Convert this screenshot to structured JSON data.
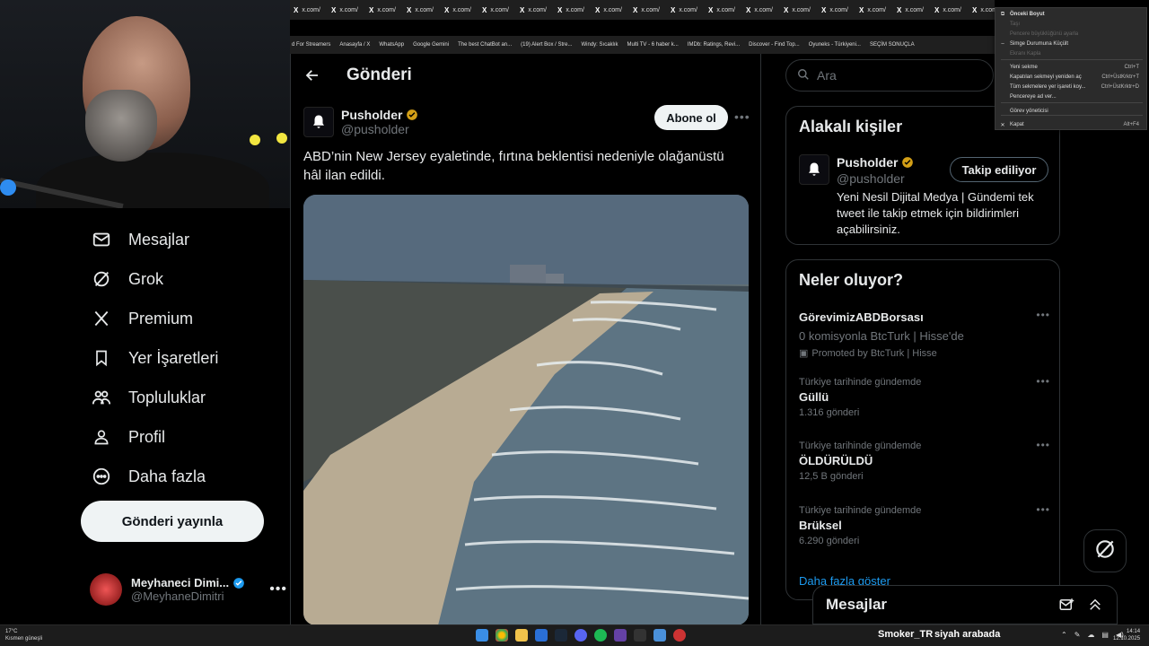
{
  "browser": {
    "tab_label": "x.com/",
    "tab_count": 19,
    "bookmarks": [
      "d For Streamers",
      "Anasayfa / X",
      "WhatsApp",
      "Google Gemini",
      "The best ChatBot an...",
      "(19) Alert Box / Stre...",
      "Windy: Sıcaklık",
      "Multi TV - 6 haber k...",
      "IMDb: Ratings, Revi...",
      "Discover - Find Top...",
      "Oyuneks - Türkiyeni...",
      "SEÇİM SONUÇLA"
    ]
  },
  "context_menu": {
    "items": [
      {
        "label": "Önceki Boyut",
        "shortcut": "",
        "enabled": true,
        "bold": true
      },
      {
        "label": "Taşı",
        "shortcut": "",
        "enabled": false
      },
      {
        "label": "Pencere büyüklüğünü ayarla",
        "shortcut": "",
        "enabled": false
      },
      {
        "label": "Simge Durumuna Küçült",
        "shortcut": "",
        "enabled": true
      },
      {
        "label": "Ekranı Kapla",
        "shortcut": "",
        "enabled": false
      },
      {
        "label": "Yeni sekme",
        "shortcut": "Ctrl+T",
        "enabled": true
      },
      {
        "label": "Kapatılan sekmeyi yeniden aç",
        "shortcut": "Ctrl+ÜstKrktr+T",
        "enabled": true
      },
      {
        "label": "Tüm sekmelere yer işareti koy...",
        "shortcut": "Ctrl+ÜstKrktr+D",
        "enabled": true
      },
      {
        "label": "Pencereye ad ver...",
        "shortcut": "",
        "enabled": true
      },
      {
        "label": "Görev yöneticisi",
        "shortcut": "",
        "enabled": true
      },
      {
        "label": "Kapat",
        "shortcut": "Alt+F4",
        "enabled": true
      }
    ]
  },
  "sidebar": {
    "items": [
      {
        "label": "Mesajlar",
        "icon": "envelope-icon"
      },
      {
        "label": "Grok",
        "icon": "grok-icon"
      },
      {
        "label": "Premium",
        "icon": "x-logo-icon"
      },
      {
        "label": "Yer İşaretleri",
        "icon": "bookmark-icon"
      },
      {
        "label": "Topluluklar",
        "icon": "communities-icon"
      },
      {
        "label": "Profil",
        "icon": "person-icon"
      },
      {
        "label": "Daha fazla",
        "icon": "more-circle-icon"
      }
    ],
    "post_button": "Gönderi yayınla",
    "account": {
      "name": "Meyhaneci Dimi...",
      "handle": "@MeyhaneDimitri"
    }
  },
  "main": {
    "title": "Gönderi",
    "post": {
      "author_name": "Pusholder",
      "author_handle": "@pusholder",
      "subscribe_label": "Abone ol",
      "text": "ABD’nin New Jersey eyaletinde, fırtına beklentisi nedeniyle olağanüstü hâl ilan edildi."
    }
  },
  "right": {
    "search_placeholder": "Ara",
    "related": {
      "title": "Alakalı kişiler",
      "name": "Pusholder",
      "handle": "@pusholder",
      "follow_label": "Takip ediliyor",
      "bio": "Yeni Nesil Dijital Medya | Gündemi tek tweet ile takip etmek için bildirimleri açabilirsiniz."
    },
    "trends": {
      "title": "Neler oluyor?",
      "promoted": {
        "title": "GörevimizABDBorsası",
        "desc": "0 komisyonla BtcTurk | Hisse'de",
        "by": "Promoted by BtcTurk | Hisse"
      },
      "items": [
        {
          "context": "Türkiye tarihinde gündemde",
          "title": "Güllü",
          "count": "1.316 gönderi"
        },
        {
          "context": "Türkiye tarihinde gündemde",
          "title": "ÖLDÜRÜLDÜ",
          "count": "12,5 B gönderi"
        },
        {
          "context": "Türkiye tarihinde gündemde",
          "title": "Brüksel",
          "count": "6.290 gönderi"
        }
      ],
      "show_more": "Daha fazla göster"
    },
    "messages_drawer": "Mesajlar"
  },
  "taskbar": {
    "weather_temp": "17°C",
    "weather_desc": "Kısmen güneşli",
    "now_playing_user": "Smoker_TR",
    "now_playing_text": "siyah arabada",
    "time": "14:14",
    "date": "12.10.2025"
  },
  "colors": {
    "accent": "#1d9bf0",
    "verified": "#d4a017",
    "background": "#000000"
  }
}
